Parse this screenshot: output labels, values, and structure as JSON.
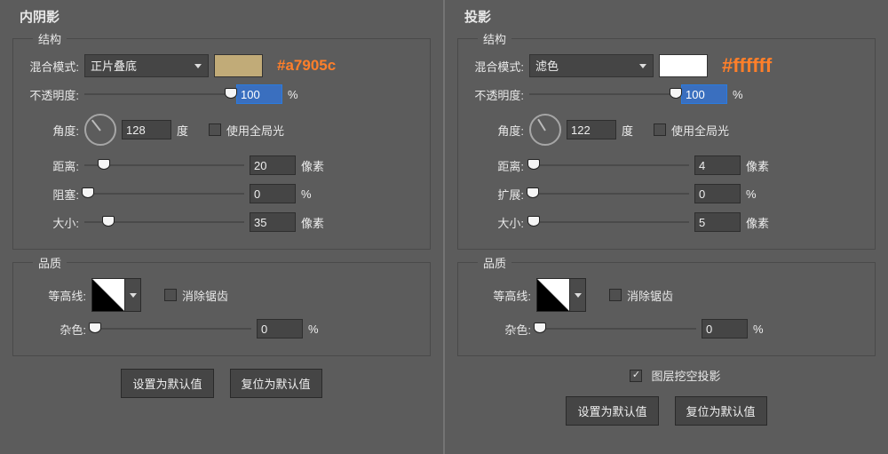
{
  "left": {
    "title": "内阴影",
    "structure": {
      "group_label": "结构",
      "blend_label": "混合模式:",
      "blend_value": "正片叠底",
      "swatch_color": "#c1ab78",
      "swatch_hex_label": "#a7905c",
      "opacity_label": "不透明度:",
      "opacity_value": "100",
      "opacity_unit": "%",
      "angle_label": "角度:",
      "angle_value": "128",
      "angle_unit": "度",
      "global_light_label": "使用全局光",
      "global_light_checked": false,
      "distance_label": "距离:",
      "distance_value": "20",
      "distance_unit": "像素",
      "choke_label": "阻塞:",
      "choke_value": "0",
      "choke_unit": "%",
      "size_label": "大小:",
      "size_value": "35",
      "size_unit": "像素"
    },
    "quality": {
      "group_label": "品质",
      "contour_label": "等高线:",
      "antialias_label": "消除锯齿",
      "antialias_checked": false,
      "noise_label": "杂色:",
      "noise_value": "0",
      "noise_unit": "%"
    },
    "buttons": {
      "default": "设置为默认值",
      "reset": "复位为默认值"
    }
  },
  "right": {
    "title": "投影",
    "structure": {
      "group_label": "结构",
      "blend_label": "混合模式:",
      "blend_value": "滤色",
      "swatch_color": "#ffffff",
      "swatch_hex_label": "#ffffff",
      "opacity_label": "不透明度:",
      "opacity_value": "100",
      "opacity_unit": "%",
      "angle_label": "角度:",
      "angle_value": "122",
      "angle_unit": "度",
      "global_light_label": "使用全局光",
      "global_light_checked": false,
      "distance_label": "距离:",
      "distance_value": "4",
      "distance_unit": "像素",
      "spread_label": "扩展:",
      "spread_value": "0",
      "spread_unit": "%",
      "size_label": "大小:",
      "size_value": "5",
      "size_unit": "像素"
    },
    "quality": {
      "group_label": "品质",
      "contour_label": "等高线:",
      "antialias_label": "消除锯齿",
      "antialias_checked": false,
      "noise_label": "杂色:",
      "noise_value": "0",
      "noise_unit": "%"
    },
    "knockout": {
      "label": "图层挖空投影",
      "checked": true
    },
    "buttons": {
      "default": "设置为默认值",
      "reset": "复位为默认值"
    }
  }
}
